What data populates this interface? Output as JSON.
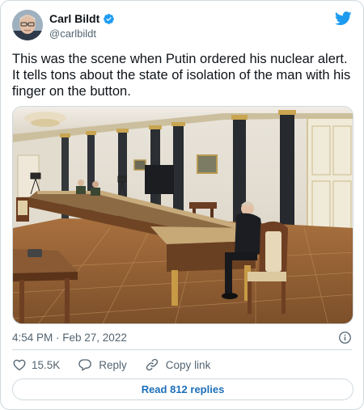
{
  "author": {
    "name": "Carl Bildt",
    "handle": "@carlbildt"
  },
  "tweet": {
    "text": "This was the scene when Putin ordered his nuclear alert. It tells tons about the state of isolation of the man with his finger on the button.",
    "timestamp": "4:54 PM · Feb 27, 2022"
  },
  "actions": {
    "likes": "15.5K",
    "reply_label": "Reply",
    "copy_link_label": "Copy link"
  },
  "replies_button": {
    "label": "Read 812 replies"
  },
  "colors": {
    "brand_blue": "#1d9bf0",
    "like_red": "#f91880",
    "text_secondary": "#536471",
    "border": "#cfd9de"
  },
  "icons": [
    "verified-badge-icon",
    "twitter-bird-icon",
    "info-icon",
    "heart-icon",
    "reply-bubble-icon",
    "link-icon"
  ]
}
